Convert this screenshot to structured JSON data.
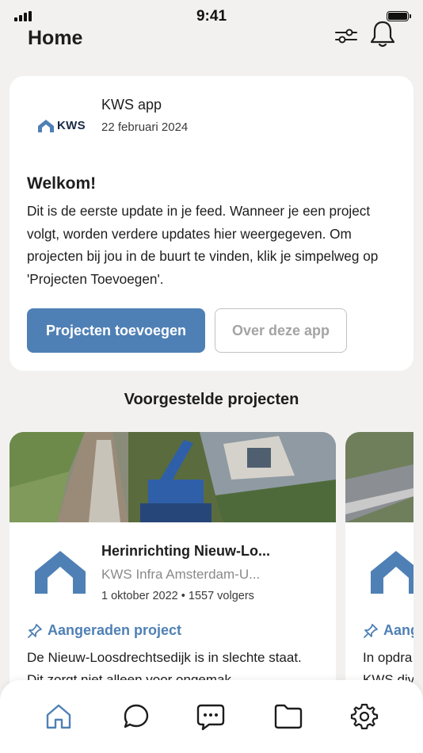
{
  "status_bar": {
    "time": "9:41"
  },
  "header": {
    "title": "Home",
    "icons": [
      "filter-icon",
      "bell-icon"
    ]
  },
  "feed_card": {
    "logo_text": "KWS",
    "source": "KWS app",
    "date": "22 februari 2024",
    "title": "Welkom!",
    "body": "Dit is de eerste update in je feed. Wanneer je een project volgt, worden verdere updates hier weergegeven. Om projecten bij jou in de buurt te vinden, klik je simpelweg op 'Projecten Toevoegen'.",
    "primary_button": "Projecten toevoegen",
    "secondary_button": "Over deze app"
  },
  "suggested": {
    "title": "Voorgestelde projecten",
    "cards": [
      {
        "name": "Herinrichting Nieuw-Lo...",
        "org": "KWS Infra Amsterdam-U...",
        "meta": "1 oktober 2022 • 1557 volgers",
        "tag": "Aangeraden project",
        "description": "De Nieuw-Loosdrechtsedijk is in slechte staat. Dit zorgt niet alleen voor ongemak"
      },
      {
        "name": "",
        "org": "",
        "meta": "",
        "tag": "Aang",
        "description": "In opdra KWS div"
      }
    ]
  },
  "tab_bar": {
    "items": [
      "home",
      "chat",
      "messages",
      "folder",
      "settings"
    ],
    "active": "home"
  },
  "colors": {
    "accent": "#4f80b5",
    "background": "#f2f1f0",
    "card": "#ffffff",
    "muted": "#8a8a8a"
  }
}
